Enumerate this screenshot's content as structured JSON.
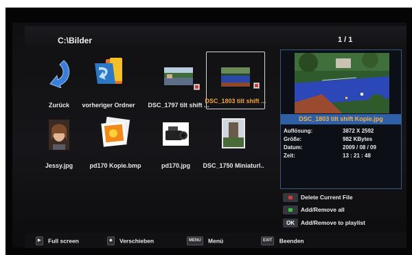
{
  "header": {
    "path": "C:\\Bilder",
    "page": "1 / 1"
  },
  "tiles": [
    {
      "label": "Zurück",
      "icon": "back-arrow-icon"
    },
    {
      "label": "vorheriger Ordner",
      "icon": "folder-up-icon"
    },
    {
      "label": "DSC_1797 tilt shift ...",
      "icon": "photo-thumbnail"
    },
    {
      "label": "DSC_1803 tilt shift ...",
      "icon": "photo-thumbnail"
    },
    {
      "label": "Jessy.jpg",
      "icon": "photo-thumbnail"
    },
    {
      "label": "pd170 Kopie.bmp",
      "icon": "photo-thumbnail"
    },
    {
      "label": "pd170.jpg",
      "icon": "photo-thumbnail"
    },
    {
      "label": "DSC_1750 Miniaturl..",
      "icon": "photo-thumbnail"
    }
  ],
  "selected_index": 3,
  "preview": {
    "filename": "DSC_1803 tilt shift Kopie.jpg",
    "info": [
      {
        "key": "Auflösung:",
        "value": "3872 X 2592"
      },
      {
        "key": "Größe:",
        "value": "982 KBytes"
      },
      {
        "key": "Datum:",
        "value": "2009 / 08 / 09"
      },
      {
        "key": "Zeit:",
        "value": "13 : 21 : 48"
      }
    ]
  },
  "legend": [
    {
      "key": "",
      "color": "#d43a3a",
      "label": "Delete Current File"
    },
    {
      "key": "",
      "color": "#3fbf3f",
      "label": "Add/Remove all"
    },
    {
      "key": "OK",
      "color": "",
      "label": "Add/Remove to playlist"
    }
  ],
  "hints": [
    {
      "key": "▶",
      "label": "Full screen"
    },
    {
      "key": "◆",
      "label": "Verschieben"
    },
    {
      "key": "MENU",
      "label": "Menü"
    },
    {
      "key": "EXIT",
      "label": "Beenden"
    }
  ],
  "colors": {
    "accent": "#2f5fa6",
    "selected_text": "#f0a13a",
    "background": "#111114"
  }
}
